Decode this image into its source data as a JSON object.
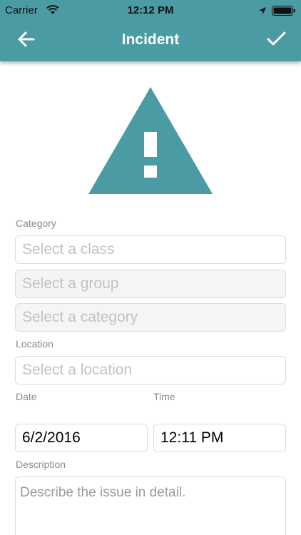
{
  "status_bar": {
    "carrier": "Carrier",
    "time": "12:12 PM",
    "icons": [
      "wifi-icon",
      "location-arrow-icon",
      "battery-icon"
    ]
  },
  "header": {
    "title": "Incident",
    "back_icon": "arrow-left-icon",
    "confirm_icon": "checkmark-icon",
    "color": "#4a9ba4"
  },
  "hero_icon": "warning-triangle-icon",
  "form": {
    "category_label": "Category",
    "class_placeholder": "Select a class",
    "group_placeholder": "Select a group",
    "category_placeholder": "Select a category",
    "location_label": "Location",
    "location_placeholder": "Select a location",
    "date_label": "Date",
    "time_label": "Time",
    "date_value": "6/2/2016",
    "time_value": "12:11 PM",
    "description_label": "Description",
    "description_placeholder": "Describe the issue in detail."
  }
}
